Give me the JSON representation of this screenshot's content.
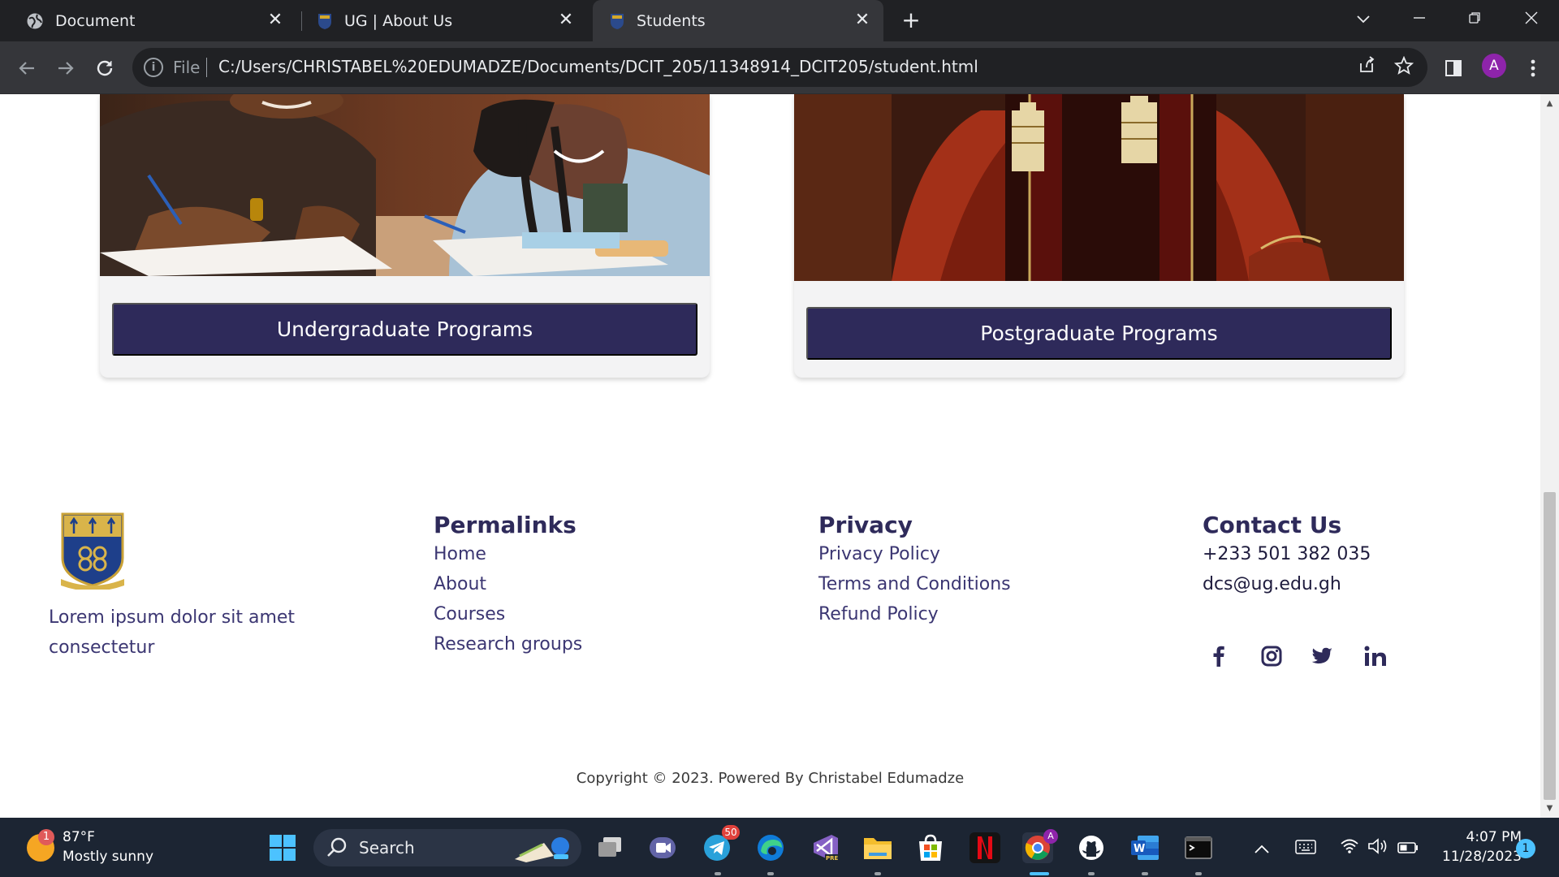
{
  "browser": {
    "tabs": [
      {
        "title": "Document",
        "icon": "globe-icon",
        "active": false
      },
      {
        "title": "UG | About Us",
        "icon": "ug-crest-icon",
        "active": false
      },
      {
        "title": "Students",
        "icon": "ug-crest-icon",
        "active": true
      }
    ],
    "close_glyph": "✕",
    "new_tab_glyph": "+",
    "address": {
      "scheme_label": "File",
      "url": "C:/Users/CHRISTABEL%20EDUMADZE/Documents/DCIT_205/11348914_DCIT205/student.html"
    },
    "profile_initial": "A"
  },
  "page": {
    "cards": [
      {
        "button_label": "Undergraduate Programs"
      },
      {
        "button_label": "Postgraduate Programs"
      }
    ],
    "footer": {
      "brand_text": "Lorem ipsum dolor sit amet consectetur",
      "permalinks": {
        "heading": "Permalinks",
        "links": [
          "Home",
          "About",
          "Courses",
          "Research groups"
        ]
      },
      "privacy": {
        "heading": "Privacy",
        "links": [
          "Privacy Policy",
          "Terms and Conditions",
          "Refund Policy"
        ]
      },
      "contact": {
        "heading": "Contact Us",
        "phone": "+233 501 382 035",
        "email": "dcs@ug.edu.gh"
      },
      "social": [
        "facebook-icon",
        "instagram-icon",
        "twitter-icon",
        "linkedin-icon"
      ],
      "copyright": "Copyright © 2023. Powered By Christabel Edumadze"
    },
    "accent_color": "#2e2a5a"
  },
  "taskbar": {
    "weather": {
      "temp": "87°F",
      "desc": "Mostly sunny",
      "badge": "1"
    },
    "search_label": "Search",
    "telegram_badge": "50",
    "chrome_profile_badge": "A",
    "clock": {
      "time": "4:07 PM",
      "date": "11/28/2023"
    },
    "notification_count": "1"
  }
}
